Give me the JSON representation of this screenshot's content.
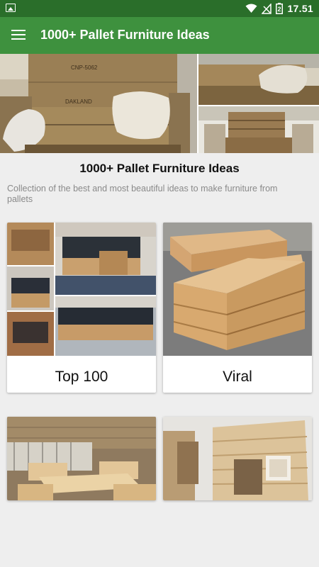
{
  "status_bar": {
    "time": "17.51",
    "battery_level": "2",
    "icons": [
      "image-notification-icon",
      "wifi-icon",
      "no-signal-icon",
      "battery-icon"
    ]
  },
  "app_bar": {
    "title": "1000+ Pallet Furniture Ideas",
    "menu_icon": "hamburger-menu-icon"
  },
  "header": {
    "title": "1000+ Pallet Furniture Ideas",
    "description": "Collection of the best and most beautiful ideas to make furniture from pallets"
  },
  "hero_images": [
    {
      "printed_text": "CNP-5062",
      "printed_text_2": "DAKLAND"
    },
    {
      "printed_text": ""
    },
    {
      "printed_text": ""
    }
  ],
  "categories": [
    {
      "label": "Top 100"
    },
    {
      "label": "Viral"
    },
    {
      "label": ""
    },
    {
      "label": ""
    }
  ],
  "colors": {
    "status_bar": "#2a6e2a",
    "app_bar": "#3e913e",
    "background": "#eeeeee",
    "card": "#ffffff"
  }
}
